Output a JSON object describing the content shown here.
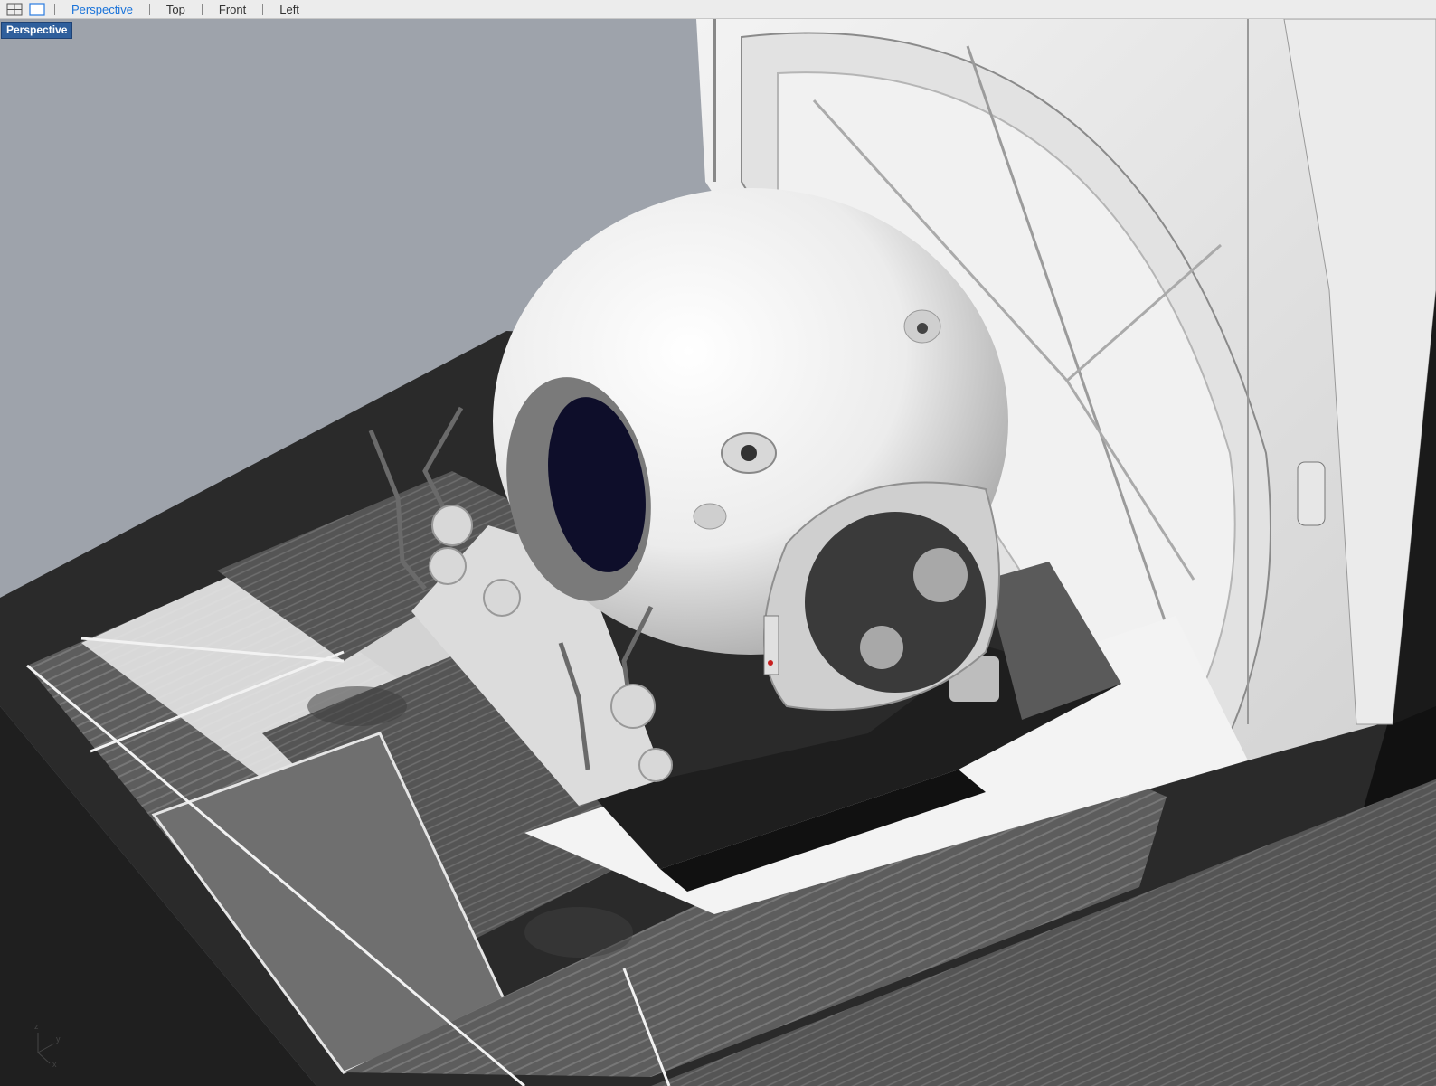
{
  "toolbar": {
    "tabs": [
      {
        "label": "Perspective",
        "active": true
      },
      {
        "label": "Top",
        "active": false
      },
      {
        "label": "Front",
        "active": false
      },
      {
        "label": "Left",
        "active": false
      }
    ]
  },
  "viewport": {
    "label": "Perspective",
    "background": "#9ea3ab",
    "axes": {
      "z": "z",
      "y": "y",
      "x": "x"
    }
  },
  "colors": {
    "active_tab": "#1a73d9",
    "viewport_label_bg": "#2f5f9c"
  }
}
